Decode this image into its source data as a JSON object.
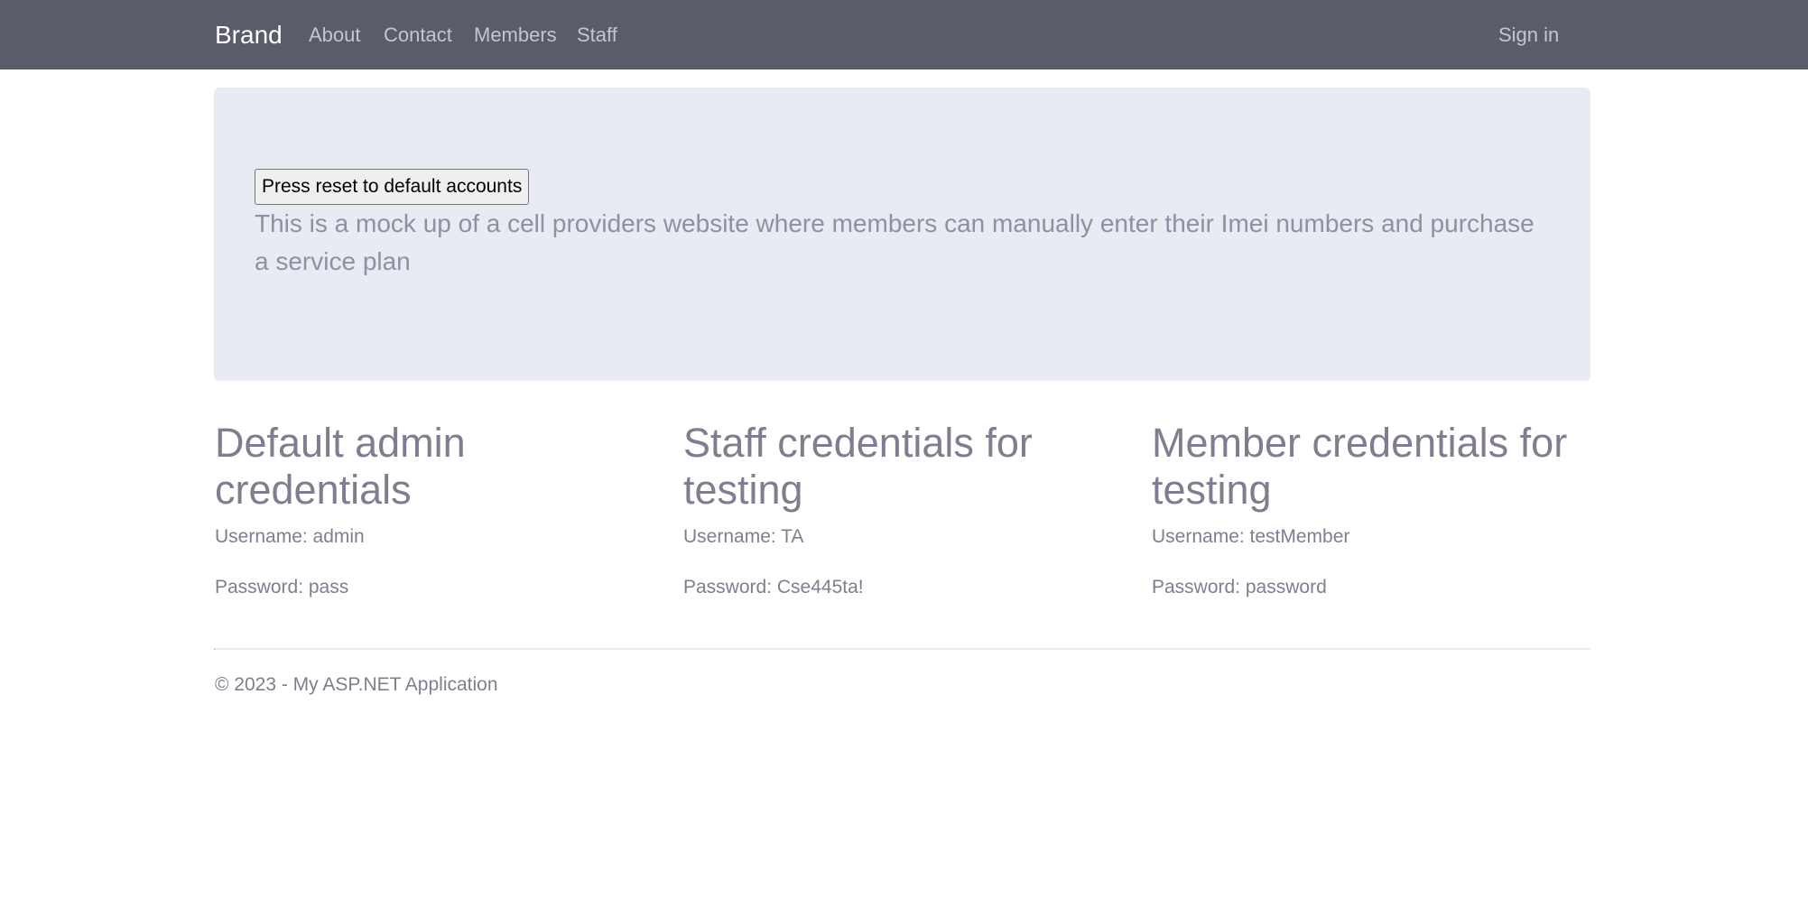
{
  "navbar": {
    "brand": "Brand",
    "links": [
      "About",
      "Contact",
      "Members",
      "Staff"
    ],
    "sign_in": "Sign in"
  },
  "jumbotron": {
    "reset_button": "Press reset to default accounts",
    "description": "This is a mock up of a cell providers website where members can manually enter their Imei numbers and purchase a service plan"
  },
  "columns": [
    {
      "heading": "Default admin credentials",
      "username": "Username: admin",
      "password": "Password: pass"
    },
    {
      "heading": "Staff credentials for testing",
      "username": "Username: TA",
      "password": "Password: Cse445ta!"
    },
    {
      "heading": "Member credentials for testing",
      "username": "Username: testMember",
      "password": "Password: password"
    }
  ],
  "footer": {
    "text": "© 2023 - My ASP.NET Application"
  },
  "colors": {
    "navbar_bg": "#5a5c6a",
    "jumbotron_bg": "#e8ebf2",
    "text": "#7d7f91"
  }
}
